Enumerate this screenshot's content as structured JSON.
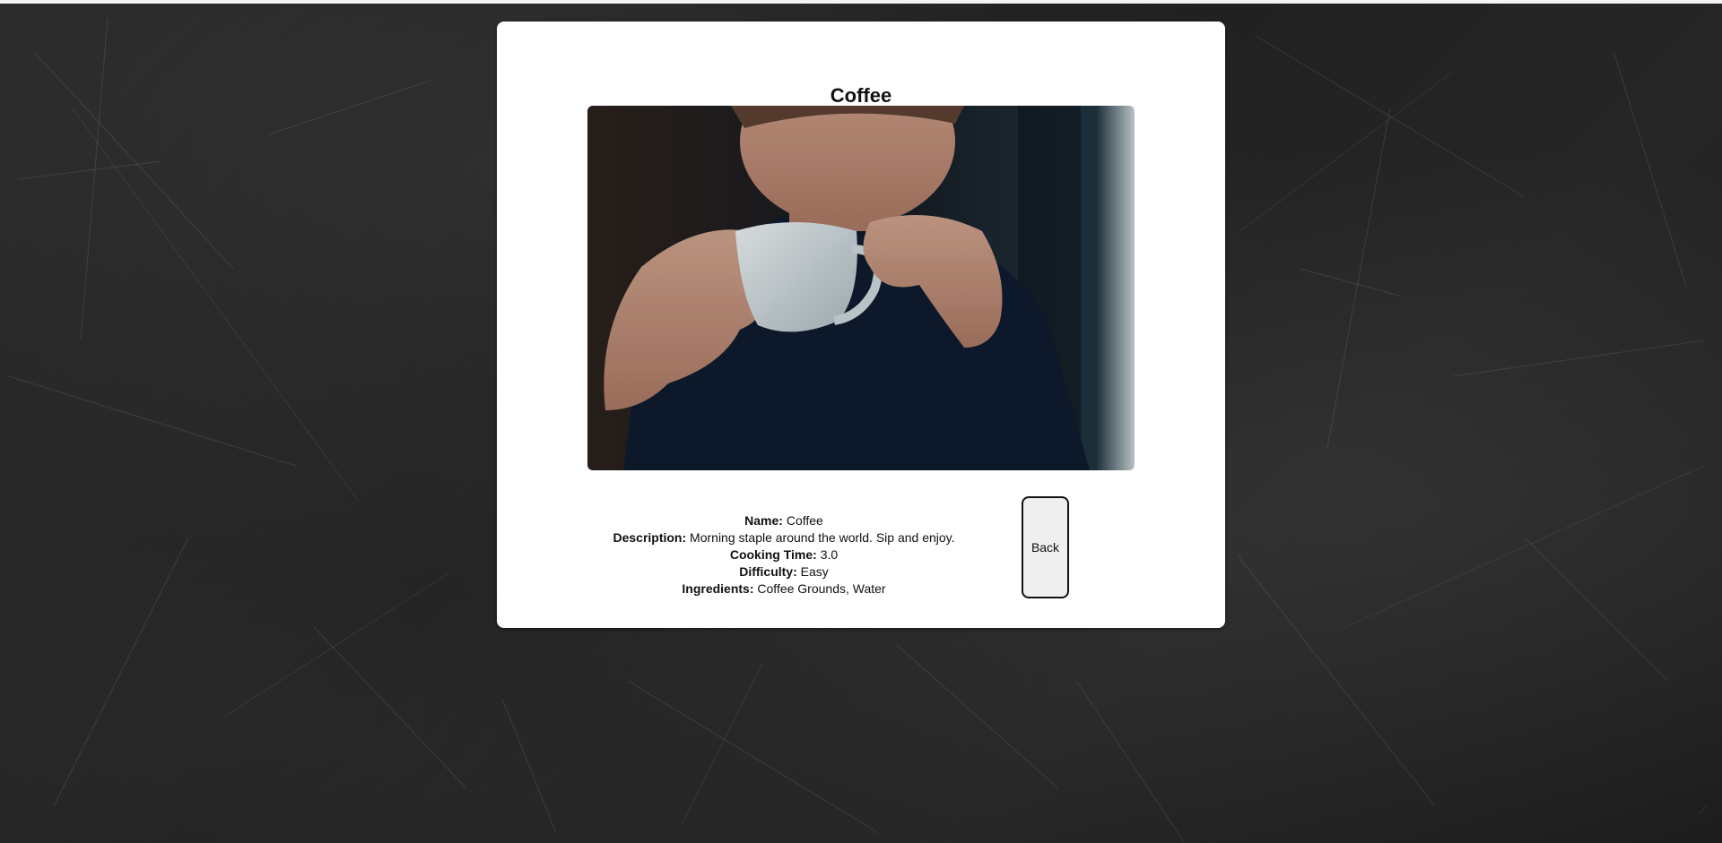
{
  "page": {
    "background_color": "#222222",
    "card_color": "#ffffff"
  },
  "recipe": {
    "title": "Coffee",
    "image_alt": "Person sipping coffee from a white cup",
    "fields": [
      {
        "label": "Name:",
        "value": "Coffee"
      },
      {
        "label": "Description:",
        "value": "Morning staple around the world. Sip and enjoy."
      },
      {
        "label": "Cooking Time:",
        "value": "3.0"
      },
      {
        "label": "Difficulty:",
        "value": "Easy"
      },
      {
        "label": "Ingredients:",
        "value": "Coffee Grounds, Water"
      }
    ]
  },
  "actions": {
    "back_label": "Back"
  },
  "icons": {
    "corner": "resize-corner-icon"
  }
}
